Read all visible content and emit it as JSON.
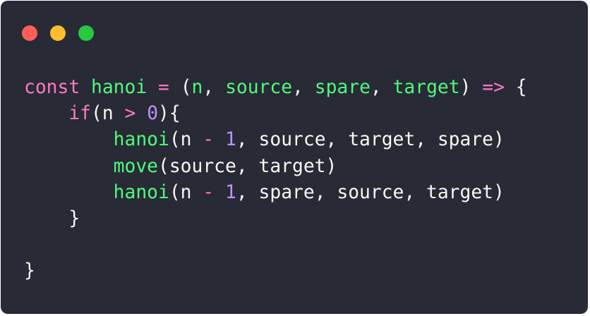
{
  "window": {
    "controls": {
      "close_color": "#ff5f56",
      "minimize_color": "#ffbd2e",
      "maximize_color": "#27c93f"
    },
    "background_color": "#282a36"
  },
  "syntax_colors": {
    "keyword": "#ff79c6",
    "function": "#50fa7b",
    "number": "#bd93f9",
    "plain": "#f8f8f2"
  },
  "code": {
    "lines": [
      [
        {
          "t": "kw",
          "text": "const"
        },
        {
          "t": "pl",
          "text": " "
        },
        {
          "t": "fn",
          "text": "hanoi"
        },
        {
          "t": "pl",
          "text": " "
        },
        {
          "t": "op",
          "text": "="
        },
        {
          "t": "pl",
          "text": " ("
        },
        {
          "t": "fn",
          "text": "n"
        },
        {
          "t": "pl",
          "text": ", "
        },
        {
          "t": "fn",
          "text": "source"
        },
        {
          "t": "pl",
          "text": ", "
        },
        {
          "t": "fn",
          "text": "spare"
        },
        {
          "t": "pl",
          "text": ", "
        },
        {
          "t": "fn",
          "text": "target"
        },
        {
          "t": "pl",
          "text": ") "
        },
        {
          "t": "op",
          "text": "=>"
        },
        {
          "t": "pl",
          "text": " {"
        }
      ],
      [
        {
          "t": "pl",
          "text": "    "
        },
        {
          "t": "kw",
          "text": "if"
        },
        {
          "t": "pl",
          "text": "(n "
        },
        {
          "t": "op",
          "text": ">"
        },
        {
          "t": "pl",
          "text": " "
        },
        {
          "t": "num",
          "text": "0"
        },
        {
          "t": "pl",
          "text": "){"
        }
      ],
      [
        {
          "t": "pl",
          "text": "        "
        },
        {
          "t": "fn",
          "text": "hanoi"
        },
        {
          "t": "pl",
          "text": "(n "
        },
        {
          "t": "op",
          "text": "-"
        },
        {
          "t": "pl",
          "text": " "
        },
        {
          "t": "num",
          "text": "1"
        },
        {
          "t": "pl",
          "text": ", source, target, spare)"
        }
      ],
      [
        {
          "t": "pl",
          "text": "        "
        },
        {
          "t": "fn",
          "text": "move"
        },
        {
          "t": "pl",
          "text": "(source, target)"
        }
      ],
      [
        {
          "t": "pl",
          "text": "        "
        },
        {
          "t": "fn",
          "text": "hanoi"
        },
        {
          "t": "pl",
          "text": "(n "
        },
        {
          "t": "op",
          "text": "-"
        },
        {
          "t": "pl",
          "text": " "
        },
        {
          "t": "num",
          "text": "1"
        },
        {
          "t": "pl",
          "text": ", spare, source, target)"
        }
      ],
      [
        {
          "t": "pl",
          "text": "    }"
        }
      ],
      [],
      [
        {
          "t": "pl",
          "text": "}"
        }
      ]
    ]
  }
}
